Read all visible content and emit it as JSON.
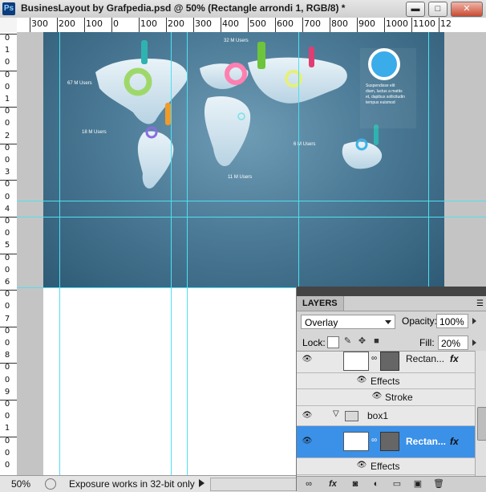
{
  "window": {
    "app_icon": "Ps",
    "title": "BusinesLayout by Grafpedia.psd @ 50% (Rectangle arrondi 1, RGB/8) *",
    "minimize": "▬",
    "maximize": "□",
    "close": "✕"
  },
  "ruler": {
    "h_labels": [
      "300",
      "200",
      "100",
      "0",
      "100",
      "200",
      "300",
      "400",
      "500",
      "600",
      "700",
      "800",
      "900",
      "1000",
      "1100",
      "12"
    ],
    "v_labels": [
      "0",
      "1",
      "0",
      "0",
      "0",
      "1",
      "0",
      "0",
      "2",
      "0",
      "0",
      "3",
      "0",
      "0",
      "4",
      "0",
      "0",
      "5",
      "0",
      "0",
      "6",
      "0",
      "0",
      "7",
      "0",
      "0",
      "8",
      "0",
      "0",
      "9",
      "0",
      "0",
      "1",
      "0",
      "0",
      "0"
    ]
  },
  "map": {
    "labels": [
      "32 M Users",
      "67 M Users",
      "18 M Users",
      "11 M Users",
      "6 M Users",
      "Suspendisse elit diam, luctus a mattis et, dapibus sollicitudin tempus euismod"
    ]
  },
  "status": {
    "zoom": "50%",
    "message": "Exposure works in 32-bit only"
  },
  "layers": {
    "tab": "LAYERS",
    "blend_mode": "Overlay",
    "opacity_label": "Opacity:",
    "opacity": "100%",
    "lock_label": "Lock:",
    "fill_label": "Fill:",
    "fill": "20%",
    "rows": [
      {
        "name": "Rectan...",
        "fx": "fx"
      },
      {
        "name": "Effects"
      },
      {
        "name": "Stroke"
      },
      {
        "name": "box1"
      },
      {
        "name": "Rectan...",
        "fx": "fx"
      },
      {
        "name": "Effects"
      }
    ]
  },
  "icons": {
    "eye": "eye-icon",
    "link": "link-icon",
    "fx": "fx-icon",
    "mask": "mask-icon",
    "adjust": "adjustment-icon",
    "folder": "folder-icon",
    "new": "new-layer-icon",
    "trash": "trash-icon"
  },
  "colors": {
    "accent": "#3b90e8",
    "guide": "#4ee0f0",
    "map_bg": "#4d7c98"
  }
}
